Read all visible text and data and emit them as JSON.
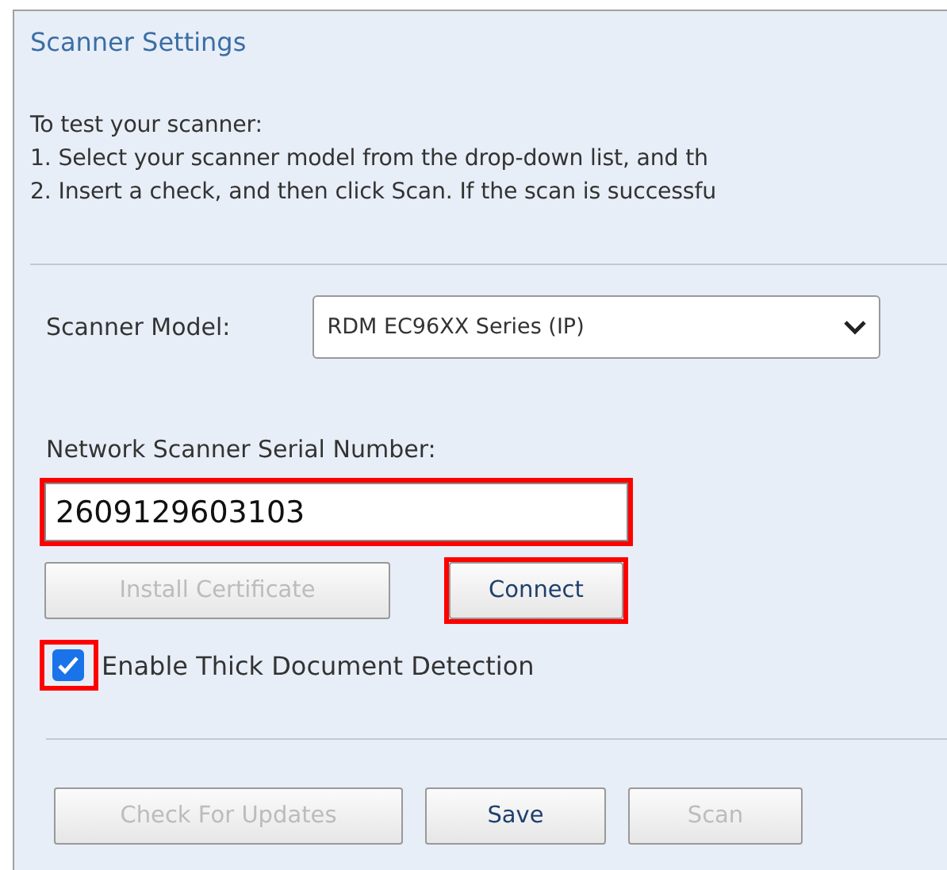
{
  "panel": {
    "title": "Scanner Settings"
  },
  "instructions": [
    "To test your scanner:",
    "1. Select your scanner model from the drop-down list, and th",
    "2. Insert a check, and then click Scan. If the scan is successfu"
  ],
  "scanner_model": {
    "label": "Scanner Model:",
    "value": "RDM EC96XX Series (IP)"
  },
  "serial": {
    "label": "Network Scanner Serial Number:",
    "value": "2609129603103",
    "highlighted": true
  },
  "device_buttons": [
    {
      "label": "Install Certificate",
      "disabled": true,
      "highlighted": false
    },
    {
      "label": "Connect",
      "disabled": false,
      "highlighted": true
    }
  ],
  "thick_detection": {
    "label": "Enable Thick Document Detection",
    "checked": true,
    "highlighted": true
  },
  "footer_buttons": [
    {
      "label": "Check For Updates",
      "disabled": true
    },
    {
      "label": "Save",
      "disabled": false
    },
    {
      "label": "Scan",
      "disabled": true
    }
  ]
}
